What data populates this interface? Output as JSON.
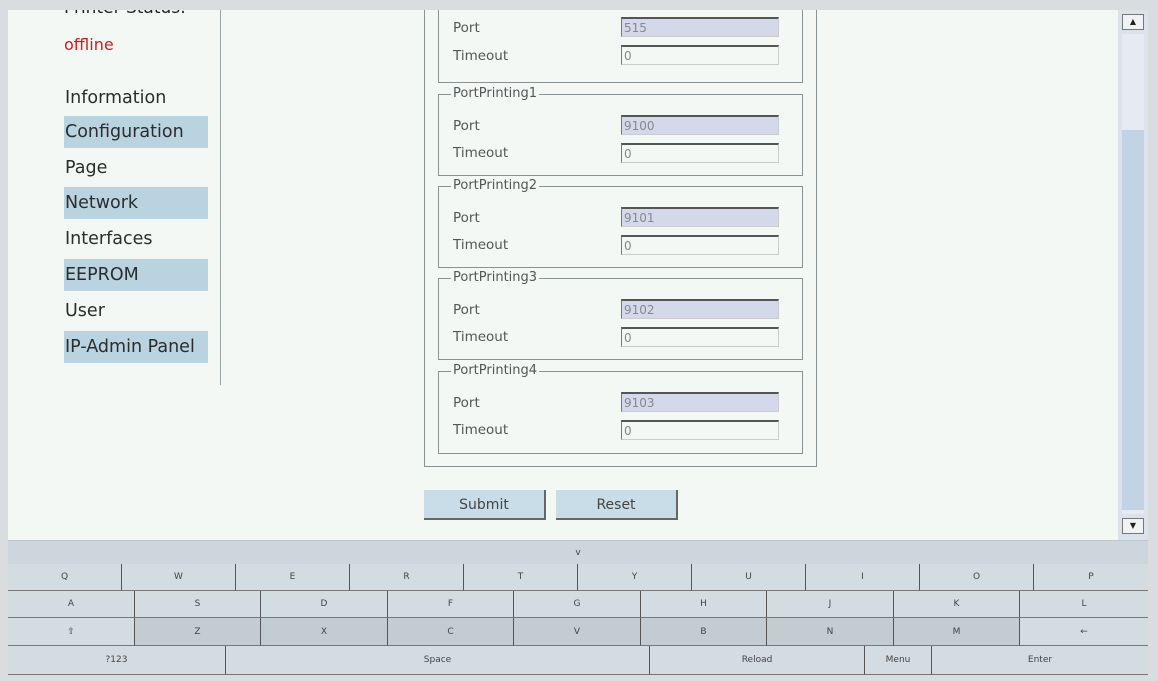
{
  "sidebar": {
    "status_label": "Printer Status:",
    "status_value": "offline",
    "items": [
      {
        "label": "Information"
      },
      {
        "label": "Configuration"
      },
      {
        "label": "Page"
      },
      {
        "label": "Network"
      },
      {
        "label": "Interfaces"
      },
      {
        "label": "EEPROM"
      },
      {
        "label": "User"
      },
      {
        "label": "IP-Admin Panel"
      }
    ]
  },
  "form": {
    "top_group": {
      "port_label": "Port",
      "port_value": "515",
      "timeout_label": "Timeout",
      "timeout_value": "0"
    },
    "groups": [
      {
        "legend": "PortPrinting1",
        "port_label": "Port",
        "port_value": "9100",
        "timeout_label": "Timeout",
        "timeout_value": "0"
      },
      {
        "legend": "PortPrinting2",
        "port_label": "Port",
        "port_value": "9101",
        "timeout_label": "Timeout",
        "timeout_value": "0"
      },
      {
        "legend": "PortPrinting3",
        "port_label": "Port",
        "port_value": "9102",
        "timeout_label": "Timeout",
        "timeout_value": "0"
      },
      {
        "legend": "PortPrinting4",
        "port_label": "Port",
        "port_value": "9103",
        "timeout_label": "Timeout",
        "timeout_value": "0"
      }
    ],
    "submit_label": "Submit",
    "reset_label": "Reset"
  },
  "scrollbar": {
    "up_icon": "▲",
    "down_icon": "▼"
  },
  "keyboard": {
    "toggle_icon": "v",
    "row1": [
      "Q",
      "W",
      "E",
      "R",
      "T",
      "Y",
      "U",
      "I",
      "O",
      "P"
    ],
    "row2": [
      "A",
      "S",
      "D",
      "F",
      "G",
      "H",
      "J",
      "K",
      "L"
    ],
    "row3": [
      "⇧",
      "Z",
      "X",
      "C",
      "V",
      "B",
      "N",
      "M",
      "←"
    ],
    "row4": [
      "?123",
      "Space",
      "Reload",
      "Menu",
      "Enter"
    ]
  },
  "colors": {
    "status_offline": "#d11a1a",
    "highlight": "#b9d3e1",
    "port_field": "#d3d9eb"
  }
}
